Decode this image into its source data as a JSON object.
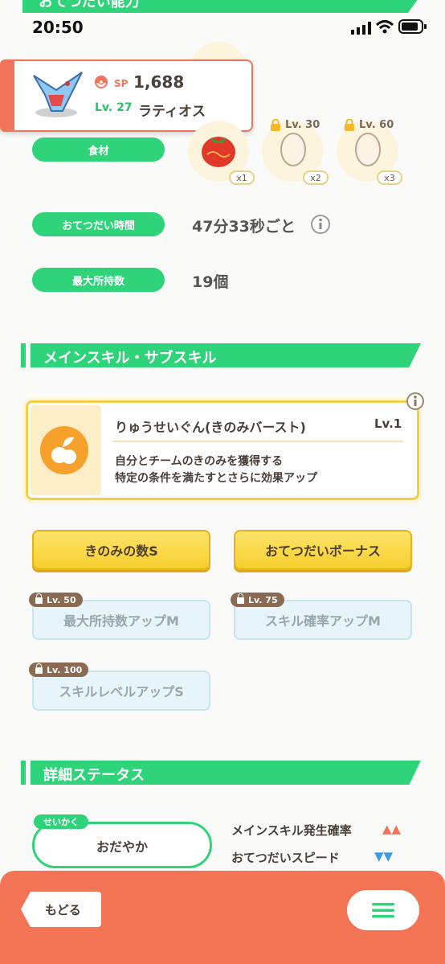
{
  "status_bar": {
    "time": "20:50"
  },
  "top_section": {
    "label": "おてつだい能力"
  },
  "pokemon_card": {
    "sp_label": "SP",
    "sp_value": "1,688",
    "level": "Lv. 27",
    "name": "ラティオス"
  },
  "stats": {
    "ingredients_label": "食材",
    "ingredients": [
      {
        "name": "tomato",
        "lock_level": "",
        "qty": "x1"
      },
      {
        "name": "egg",
        "lock_level": "Lv. 30",
        "qty": "x2"
      },
      {
        "name": "egg",
        "lock_level": "Lv. 60",
        "qty": "x3"
      }
    ],
    "help_time_label": "おてつだい時間",
    "help_time_value": "47分33秒ごと",
    "max_carry_label": "最大所持数",
    "max_carry_value": "19個"
  },
  "skill_section": {
    "title": "メインスキル・サブスキル",
    "main_skill": {
      "name": "りゅうせいぐん(きのみバースト)",
      "level": "Lv.1",
      "desc1": "自分とチームのきのみを獲得する",
      "desc2": "特定の条件を満たすとさらに効果アップ"
    },
    "sub_skills": [
      {
        "label": "きのみの数S",
        "locked": false,
        "lock_level": ""
      },
      {
        "label": "おてつだいボーナス",
        "locked": false,
        "lock_level": ""
      },
      {
        "label": "最大所持数アップM",
        "locked": true,
        "lock_level": "Lv. 50"
      },
      {
        "label": "スキル確率アップM",
        "locked": true,
        "lock_level": "Lv. 75"
      },
      {
        "label": "スキルレベルアップS",
        "locked": true,
        "lock_level": "Lv. 100"
      }
    ]
  },
  "detail_section": {
    "title": "詳細ステータス",
    "nature_tag": "せいかく",
    "nature_value": "おだやか",
    "effects": [
      {
        "label": "メインスキル発生確率",
        "arrows": "▲▲",
        "color": "#f0745a"
      },
      {
        "label": "おてつだいスピード",
        "arrows": "▼▼",
        "color": "#3a9be8"
      }
    ]
  },
  "bottom_bar": {
    "back_label": "もどる"
  },
  "colors": {
    "accent_green": "#2ed37a",
    "accent_orange": "#f37455",
    "gold": "#f6cf2e"
  }
}
